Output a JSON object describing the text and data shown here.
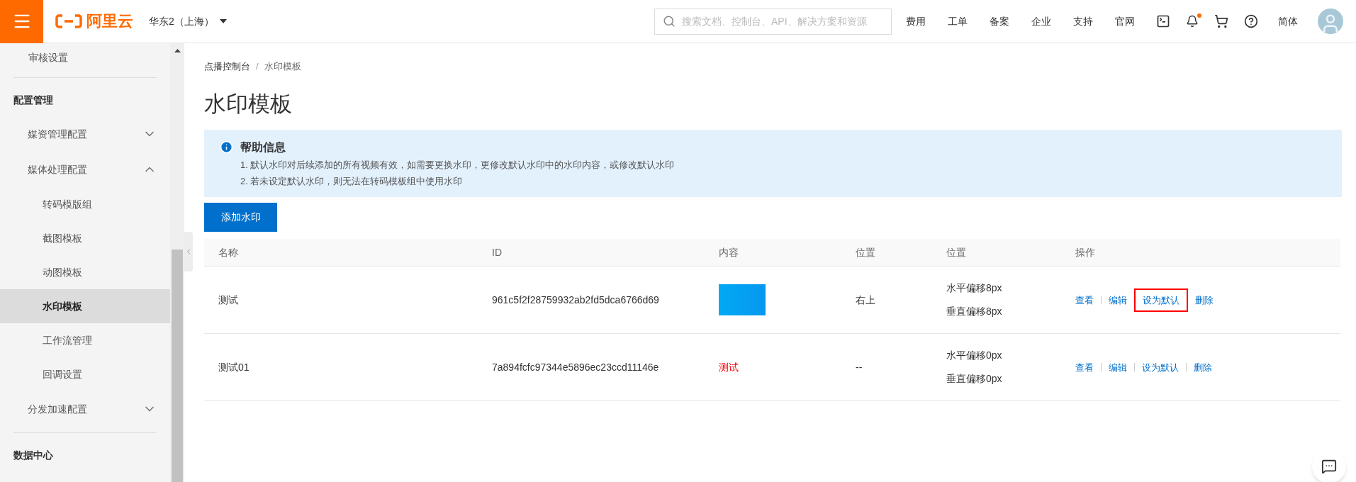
{
  "topbar": {
    "logo": "阿里云",
    "region": "华东2（上海）",
    "search": {
      "placeholder": "搜索文档、控制台、API、解决方案和资源"
    },
    "nav_links": [
      "费用",
      "工单",
      "备案",
      "企业",
      "支持",
      "官网"
    ],
    "notification_dot": true,
    "language": "简体"
  },
  "sidebar": {
    "items": [
      {
        "kind": "item",
        "label": "审核设置"
      },
      {
        "kind": "divider"
      },
      {
        "kind": "heading",
        "label": "配置管理"
      },
      {
        "kind": "group",
        "label": "媒资管理配置",
        "expanded": false
      },
      {
        "kind": "group",
        "label": "媒体处理配置",
        "expanded": true,
        "children": [
          {
            "label": "转码模版组",
            "selected": false
          },
          {
            "label": "截图模板",
            "selected": false
          },
          {
            "label": "动图模板",
            "selected": false
          },
          {
            "label": "水印模板",
            "selected": true
          },
          {
            "label": "工作流管理",
            "selected": false
          },
          {
            "label": "回调设置",
            "selected": false
          }
        ]
      },
      {
        "kind": "group",
        "label": "分发加速配置",
        "expanded": false
      },
      {
        "kind": "divider"
      },
      {
        "kind": "heading",
        "label": "数据中心"
      }
    ]
  },
  "breadcrumb": {
    "items": [
      "点播控制台",
      "水印模板"
    ],
    "separator": "/"
  },
  "page_title": "水印模板",
  "help": {
    "title": "帮助信息",
    "lines": [
      "1. 默认水印对后续添加的所有视频有效，如需要更换水印，更修改默认水印中的水印内容，或修改默认水印",
      "2. 若未设定默认水印，则无法在转码模板组中使用水印"
    ]
  },
  "add_button": "添加水印",
  "table": {
    "columns": [
      "名称",
      "ID",
      "内容",
      "位置",
      "位置",
      "操作"
    ],
    "rows": [
      {
        "name": "测试",
        "id": "961c5f2f28759932ab2fd5dca6766d69",
        "content": {
          "kind": "image"
        },
        "anchor": "右上",
        "offsets": [
          "水平偏移8px",
          "垂直偏移8px"
        ],
        "actions": [
          {
            "label": "查看",
            "highlighted": false
          },
          {
            "label": "编辑",
            "highlighted": false
          },
          {
            "label": "设为默认",
            "highlighted": true
          },
          {
            "label": "删除",
            "highlighted": false
          }
        ]
      },
      {
        "name": "测试01",
        "id": "7a894fcfc97344e5896ec23ccd11146e",
        "content": {
          "kind": "text",
          "text": "测试",
          "color": "#ff0000"
        },
        "anchor": "--",
        "offsets": [
          "水平偏移0px",
          "垂直偏移0px"
        ],
        "actions": [
          {
            "label": "查看",
            "highlighted": false
          },
          {
            "label": "编辑",
            "highlighted": false
          },
          {
            "label": "设为默认",
            "highlighted": false
          },
          {
            "label": "删除",
            "highlighted": false
          }
        ]
      }
    ]
  }
}
